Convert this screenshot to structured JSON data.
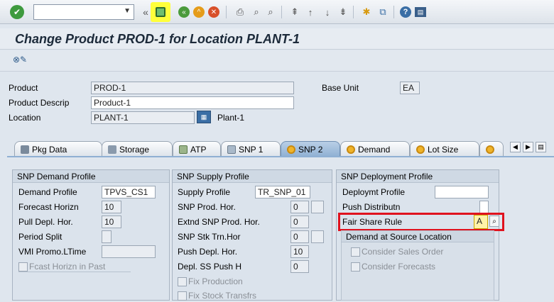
{
  "toolbar": {
    "command_field_value": "",
    "icons": [
      "enter-icon",
      "command-field-dropdown-icon",
      "collapse-icon",
      "save-icon",
      "back-icon",
      "exit-icon",
      "cancel-icon",
      "print-icon",
      "find-icon",
      "find-next-icon",
      "first-page-icon",
      "previous-page-icon",
      "next-page-icon",
      "last-page-icon",
      "create-session-icon",
      "generate-shortcut-icon",
      "help-icon",
      "customize-layout-icon"
    ]
  },
  "title": "Change Product PROD-1 for Location PLANT-1",
  "header": {
    "product_label": "Product",
    "product_value": "PROD-1",
    "product_desc_label": "Product Descrip",
    "product_desc_value": "Product-1",
    "location_label": "Location",
    "location_value": "PLANT-1",
    "location_text": "Plant-1",
    "base_unit_label": "Base Unit",
    "base_unit_value": "EA"
  },
  "tabs": [
    {
      "label": "Pkg Data",
      "active": false
    },
    {
      "label": "Storage",
      "active": false
    },
    {
      "label": "ATP",
      "active": false
    },
    {
      "label": "SNP 1",
      "active": false
    },
    {
      "label": "SNP 2",
      "active": true
    },
    {
      "label": "Demand",
      "active": false
    },
    {
      "label": "Lot Size",
      "active": false
    }
  ],
  "demand_profile": {
    "title": "SNP Demand Profile",
    "demand_profile_label": "Demand Profile",
    "demand_profile_value": "TPVS_CS1",
    "forecast_horizon_label": "Forecast Horizn",
    "forecast_horizon_value": "10",
    "pull_depl_label": "Pull Depl. Hor.",
    "pull_depl_value": "10",
    "period_split_label": "Period Split",
    "vmi_label": "VMI Promo.LTime",
    "fcast_horizon_past_label": "Fcast Horizn in Past"
  },
  "supply_profile": {
    "title": "SNP Supply Profile",
    "supply_profile_label": "Supply Profile",
    "supply_profile_value": "TR_SNP_01",
    "snp_prod_hor_label": "SNP Prod. Hor.",
    "snp_prod_hor_value": "0",
    "extnd_snp_label": "Extnd SNP Prod. Hor.",
    "extnd_snp_value": "0",
    "snp_stk_label": "SNP Stk Trn.Hor",
    "snp_stk_value": "0",
    "push_depl_label": "Push Depl. Hor.",
    "push_depl_value": "10",
    "depl_ss_label": "Depl. SS Push H",
    "depl_ss_value": "0",
    "fix_production_label": "Fix Production",
    "fix_stock_label": "Fix Stock Transfrs"
  },
  "deployment_profile": {
    "title": "SNP Deployment Profile",
    "deploymt_profile_label": "Deploymt Profile",
    "deploymt_profile_value": "",
    "push_distributn_label": "Push Distributn",
    "fair_share_label": "Fair Share Rule",
    "fair_share_value": "A",
    "demand_source_title": "Demand at Source Location",
    "consider_sales_label": "Consider Sales Order",
    "consider_forecasts_label": "Consider Forecasts"
  },
  "colors": {
    "highlight_border": "#e0121e",
    "save_highlight": "#ffff3a",
    "active_tab": "#8fb0d3"
  }
}
